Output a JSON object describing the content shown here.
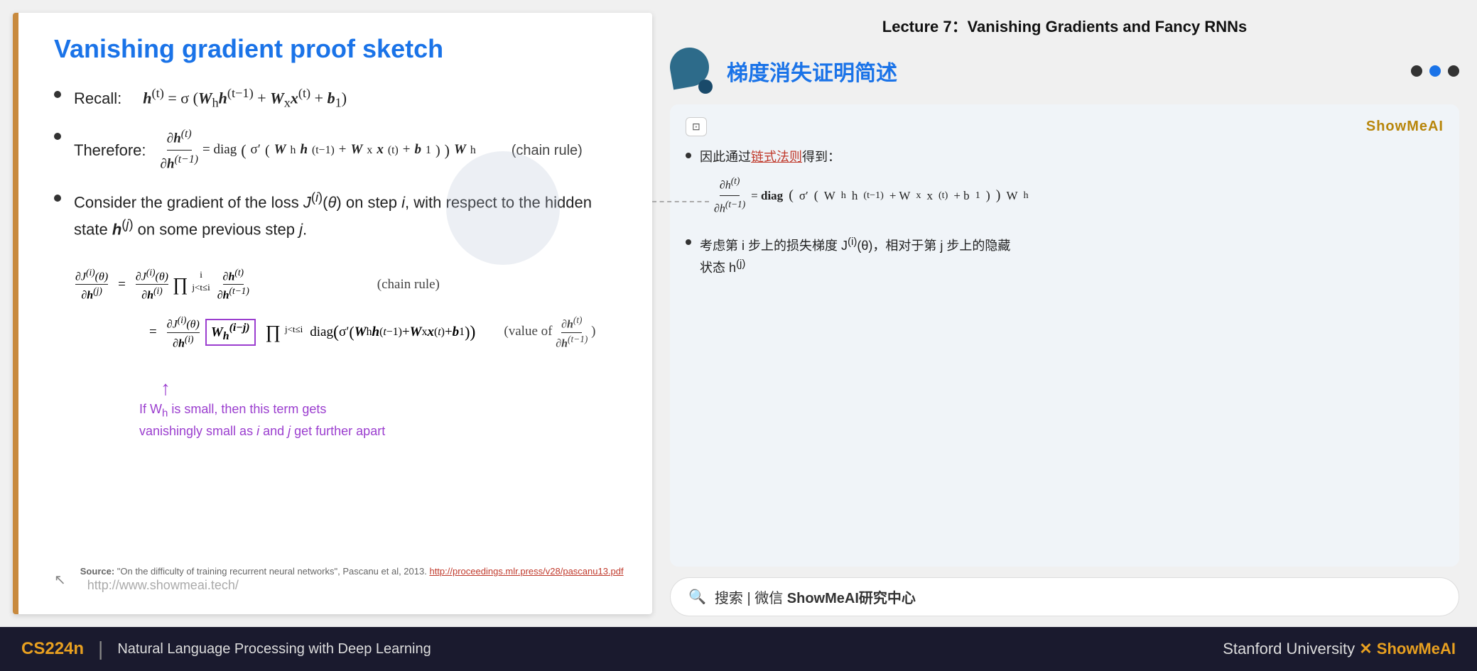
{
  "lecture": {
    "header": "Lecture 7：Vanishing Gradients and Fancy RNNs"
  },
  "slide": {
    "title": "Vanishing gradient proof sketch",
    "bullets": [
      {
        "label": "Recall:",
        "formula": "h(t) = σ(Wh h(t−1) + Wx x(t) + b1)"
      },
      {
        "label": "Therefore:",
        "formula": "∂h(t)/∂h(t−1) = diag(σ′(Wh h(t−1) + Wx x(t) + b1)) Wh",
        "note": "(chain rule)"
      },
      {
        "label": "Consider the gradient of the loss J(i)(θ) on step i, with respect to the hidden state h(j) on some previous step j."
      }
    ],
    "big_formula_line1_left": "∂J(i)(θ)/∂h(j)",
    "big_formula_line1_mid": "=",
    "big_formula_line1_right": "∂J(i)(θ)/∂h(i) · ∏(j<t≤i) ∂h(t)/∂h(t−1)",
    "big_formula_line1_note": "(chain rule)",
    "big_formula_line2_mid": "=",
    "big_formula_line2_right": "∂J(i)(θ)/∂h(i) · W_h^(i−j) · ∏(j<t≤i) diag(σ′(Wh h(t−1) + Wx x(t) + b1))",
    "big_formula_line2_note": "(value of ∂h(t)/∂h(t−1))",
    "purple_note": "If Wh is small, then this term gets\nvanishingly small as i and j get further apart",
    "source_text": "\"On the difficulty of training recurrent neural networks\", Pascanu et al, 2013.",
    "source_link": "http://proceedings.mlr.press/v28/pascanu13.pdf",
    "website": "http://www.showmeai.tech/"
  },
  "right_panel": {
    "slide_title_zh": "梯度消失证明简述",
    "nav_dots": [
      "inactive",
      "active",
      "inactive"
    ],
    "card": {
      "ai_badge": "⊡",
      "brand": "ShowMeAI",
      "bullets": [
        {
          "text_prefix": "因此通过",
          "link_text": "链式法则",
          "text_suffix": "得到：",
          "math": "∂h(t)/∂h(t−1) = diag(σ′(Wh h(t−1) + Wx x(t) + b1)) Wh"
        },
        {
          "text": "考虑第 i 步上的损失梯度 J(i)(θ)，相对于第 j 步上的隐藏状态 h(j)"
        }
      ]
    },
    "search_placeholder": "搜索 | 微信 ShowMeAI研究中心"
  },
  "bottom_bar": {
    "course_code": "CS224n",
    "divider": "|",
    "course_name": "Natural Language Processing with Deep Learning",
    "university": "Stanford University",
    "x_symbol": "✕",
    "brand": "ShowMeAI"
  }
}
